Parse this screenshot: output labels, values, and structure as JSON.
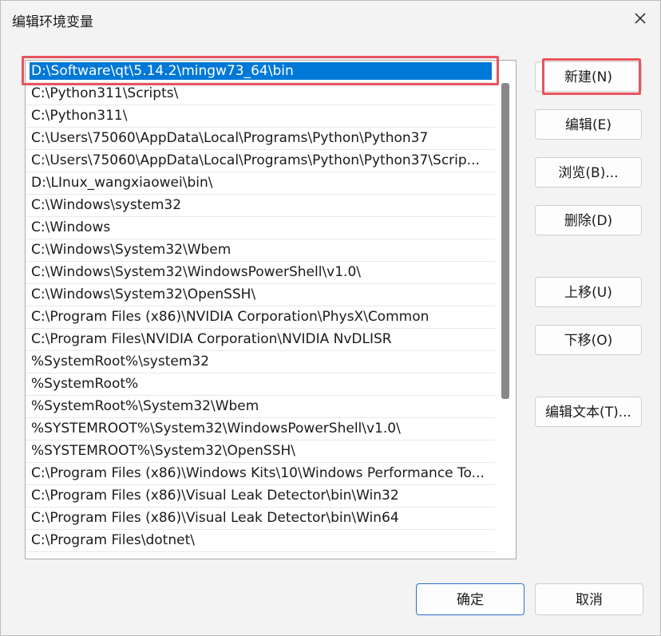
{
  "window": {
    "title": "编辑环境变量",
    "close_icon": "close-icon"
  },
  "path_list": {
    "selected_index": 0,
    "items": [
      "D:\\Software\\qt\\5.14.2\\mingw73_64\\bin",
      "C:\\Python311\\Scripts\\",
      "C:\\Python311\\",
      "C:\\Users\\75060\\AppData\\Local\\Programs\\Python\\Python37",
      "C:\\Users\\75060\\AppData\\Local\\Programs\\Python\\Python37\\Scrip...",
      "D:\\LInux_wangxiaowei\\bin\\",
      "C:\\Windows\\system32",
      "C:\\Windows",
      "C:\\Windows\\System32\\Wbem",
      "C:\\Windows\\System32\\WindowsPowerShell\\v1.0\\",
      "C:\\Windows\\System32\\OpenSSH\\",
      "C:\\Program Files (x86)\\NVIDIA Corporation\\PhysX\\Common",
      "C:\\Program Files\\NVIDIA Corporation\\NVIDIA NvDLISR",
      "%SystemRoot%\\system32",
      "%SystemRoot%",
      "%SystemRoot%\\System32\\Wbem",
      "%SYSTEMROOT%\\System32\\WindowsPowerShell\\v1.0\\",
      "%SYSTEMROOT%\\System32\\OpenSSH\\",
      "C:\\Program Files (x86)\\Windows Kits\\10\\Windows Performance To...",
      "C:\\Program Files (x86)\\Visual Leak Detector\\bin\\Win32",
      "C:\\Program Files (x86)\\Visual Leak Detector\\bin\\Win64",
      "C:\\Program Files\\dotnet\\"
    ]
  },
  "buttons": {
    "new": "新建(N)",
    "edit": "编辑(E)",
    "browse": "浏览(B)...",
    "delete": "删除(D)",
    "move_up": "上移(U)",
    "move_down": "下移(O)",
    "edit_text": "编辑文本(T)...",
    "ok": "确定",
    "cancel": "取消"
  },
  "colors": {
    "selection": "#0078d7",
    "highlight_annotation": "#e8545e",
    "primary_border": "#2b6fd0"
  }
}
